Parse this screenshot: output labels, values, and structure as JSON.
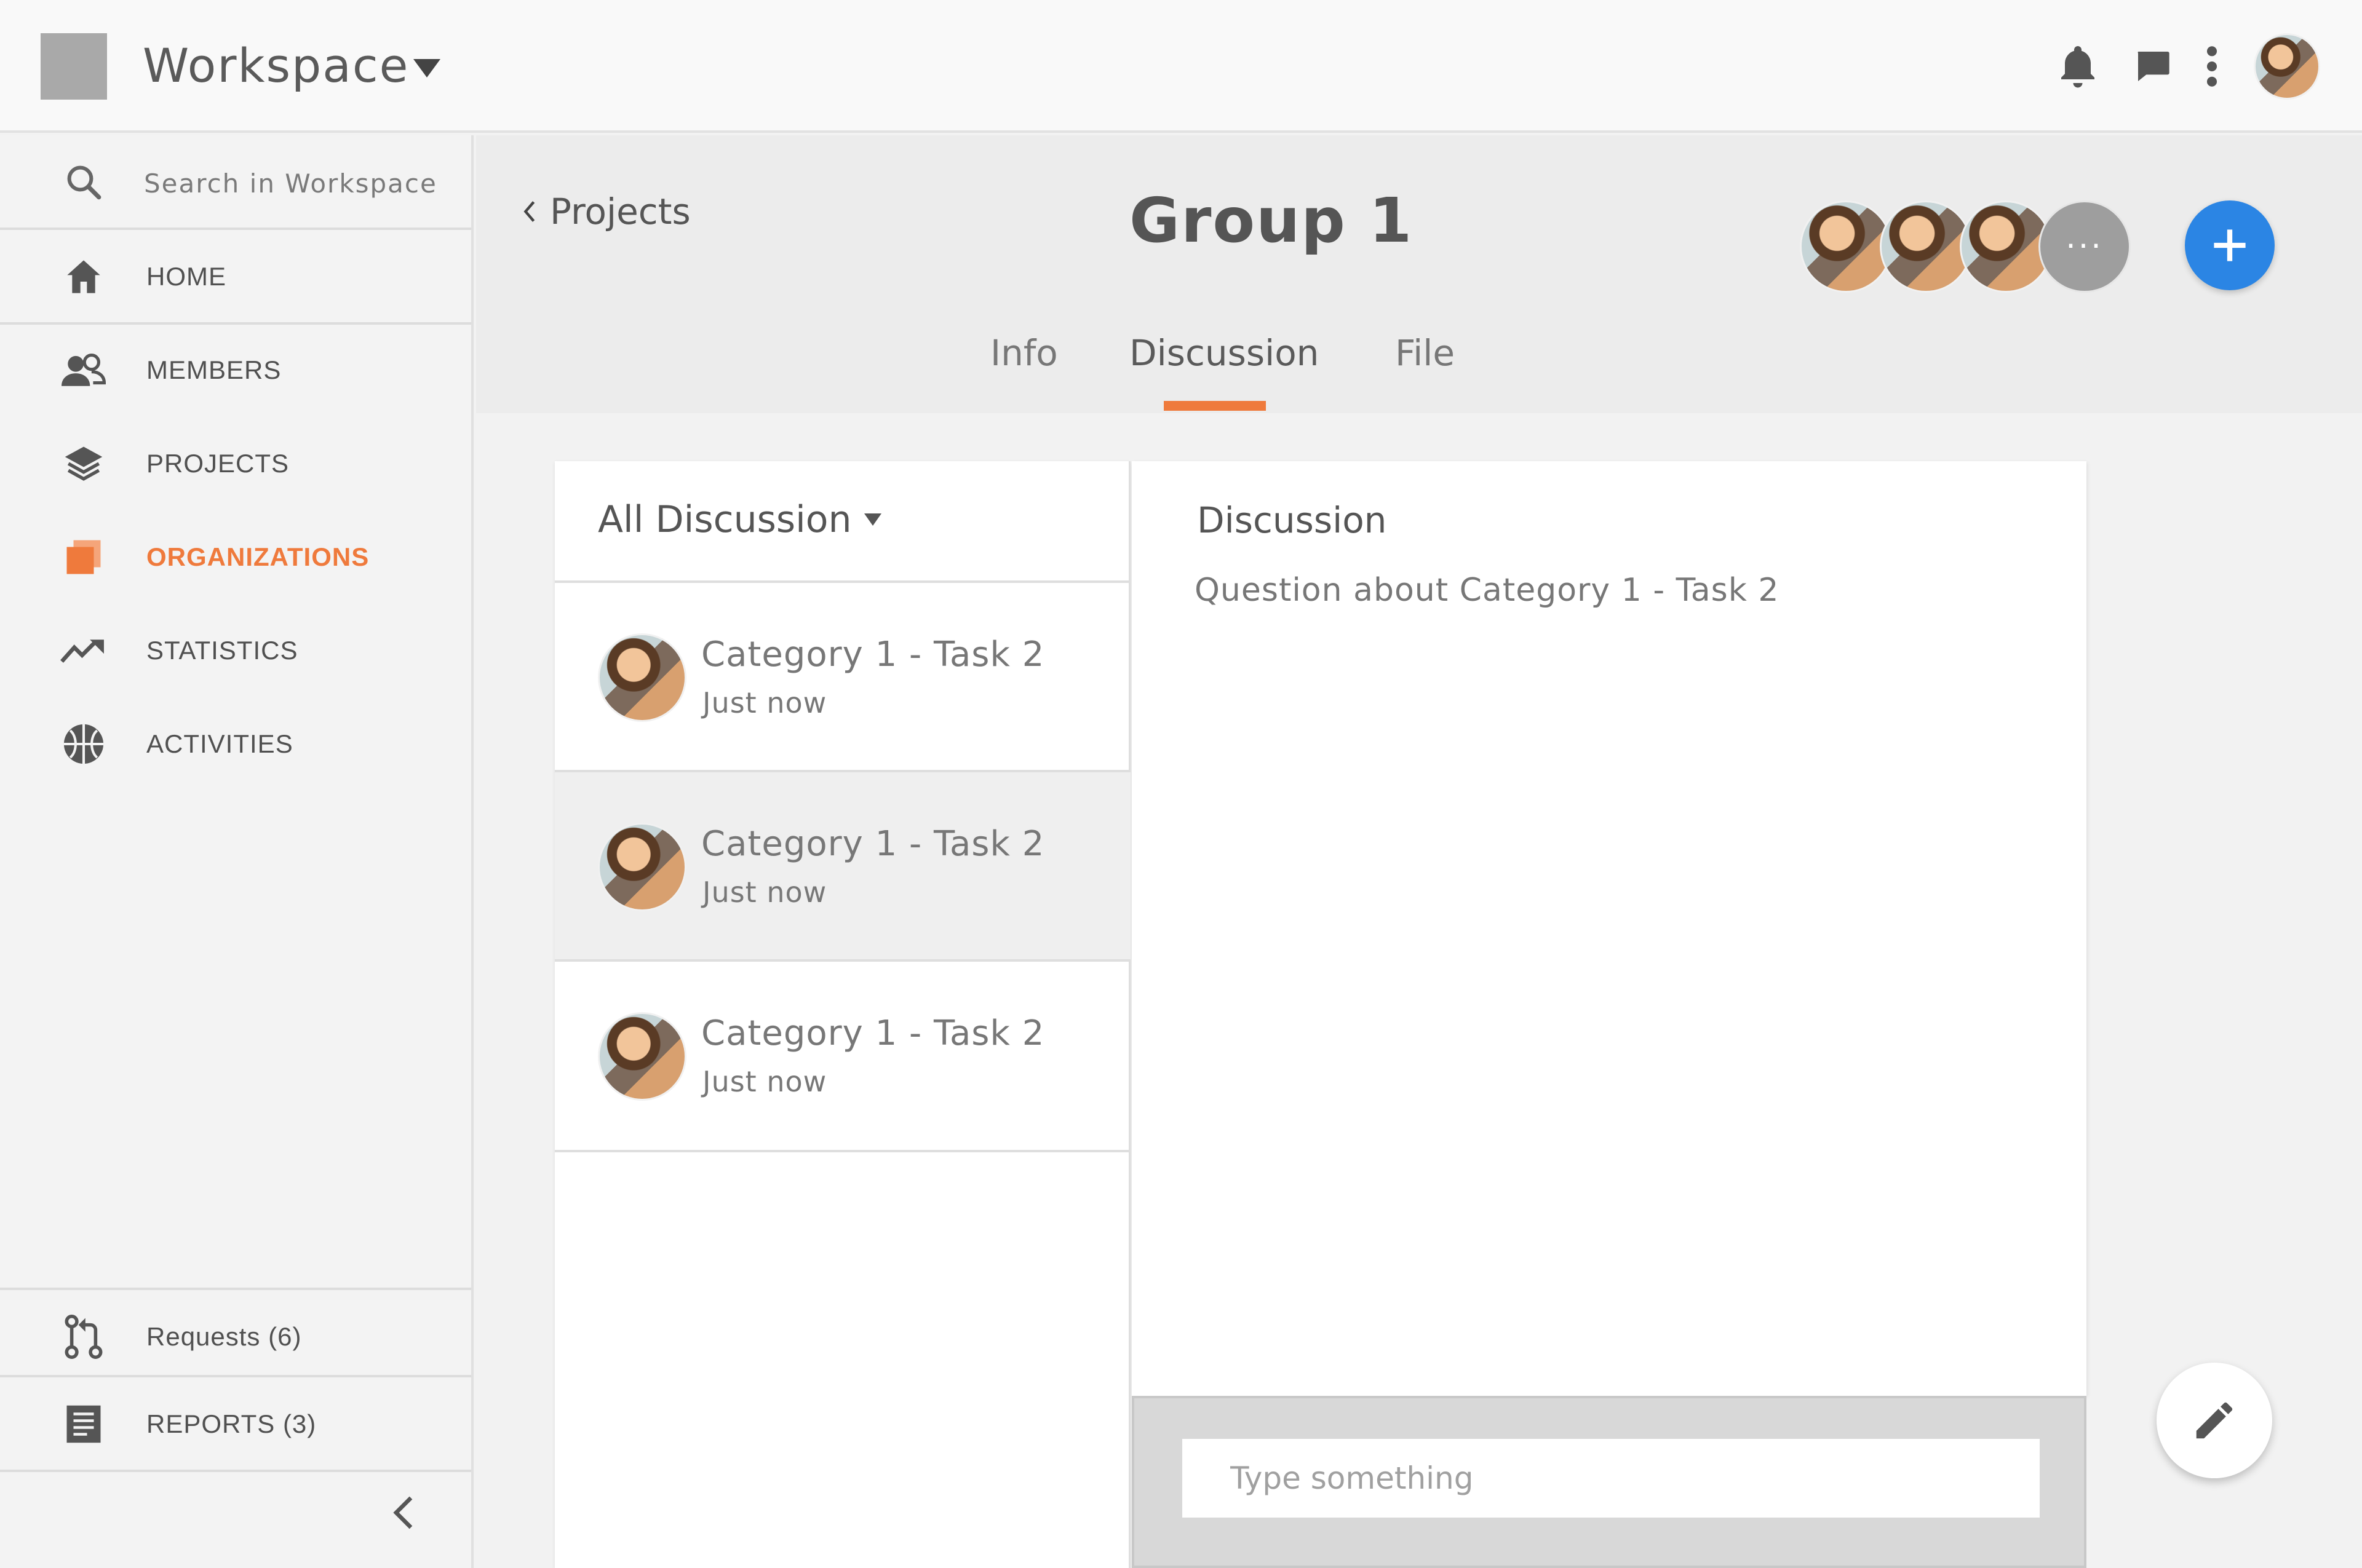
{
  "workspace": {
    "name": "Workspace"
  },
  "header_icons": [
    "bell-icon",
    "chat-icon",
    "more-vertical-icon"
  ],
  "search": {
    "placeholder": "Search in Workspace"
  },
  "sidebar": {
    "items": [
      {
        "label": "HOME",
        "icon": "home-icon"
      },
      {
        "label": "MEMBERS",
        "icon": "members-icon"
      },
      {
        "label": "PROJECTS",
        "icon": "layers-icon"
      },
      {
        "label": "ORGANIZATIONS",
        "icon": "organizations-icon",
        "active": true
      },
      {
        "label": "STATISTICS",
        "icon": "trending-up-icon"
      },
      {
        "label": "ACTIVITIES",
        "icon": "basketball-icon"
      }
    ],
    "bottom": [
      {
        "label": "Requests (6)",
        "icon": "pull-request-icon"
      },
      {
        "label": "REPORTS (3)",
        "icon": "report-icon"
      }
    ]
  },
  "breadcrumb": {
    "back_label": "Projects"
  },
  "page": {
    "title": "Group 1"
  },
  "tabs": [
    {
      "label": "Info"
    },
    {
      "label": "Discussion",
      "active": true
    },
    {
      "label": "File"
    }
  ],
  "members": {
    "more_label": "···"
  },
  "discussion_list": {
    "filter_label": "All Discussion",
    "items": [
      {
        "title": "Category 1 - Task 2",
        "time": "Just now"
      },
      {
        "title": "Category 1 - Task 2",
        "time": "Just now",
        "selected": true
      },
      {
        "title": "Category 1 - Task 2",
        "time": "Just now"
      }
    ]
  },
  "detail": {
    "title": "Discussion",
    "question": "Question about Category 1 - Task 2"
  },
  "composer": {
    "placeholder": "Type something"
  },
  "colors": {
    "accent": "#ef7a3c",
    "primary": "#2b85e4"
  }
}
